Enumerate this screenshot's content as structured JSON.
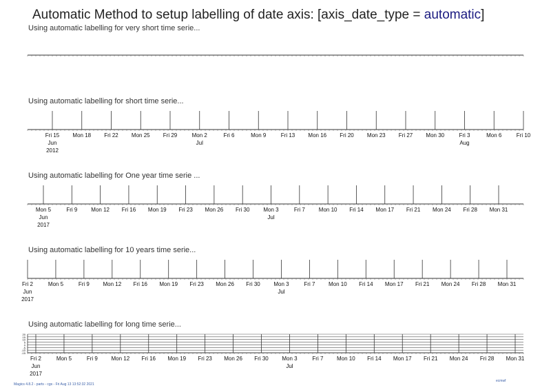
{
  "page": {
    "title_prefix": "Automatic Method to setup labelling of date axis: [axis_date_type = ",
    "title_highlight": "automatic",
    "title_suffix": "]",
    "footer": "Magics 4.8.2 - parts - cgs - Fri Aug 13 13:52:32 2021",
    "logo_text": "ecmwf"
  },
  "chart_data": [
    {
      "type": "line",
      "title": "Using automatic labelling for very short time serie...",
      "x_labels": [],
      "year_label": null,
      "grid": false
    },
    {
      "type": "line",
      "title": "Using automatic labelling for short time serie...",
      "x_labels": [
        {
          "day": "Fri 15",
          "month": "Jun",
          "year": "2012"
        },
        {
          "day": "Mon 18"
        },
        {
          "day": "Fri 22"
        },
        {
          "day": "Mon 25"
        },
        {
          "day": "Fri 29"
        },
        {
          "day": "Mon 2",
          "month": "Jul"
        },
        {
          "day": "Fri 6"
        },
        {
          "day": "Mon 9"
        },
        {
          "day": "Fri 13"
        },
        {
          "day": "Mon 16"
        },
        {
          "day": "Fri 20"
        },
        {
          "day": "Mon 23"
        },
        {
          "day": "Fri 27"
        },
        {
          "day": "Mon 30"
        },
        {
          "day": "Fri 3",
          "month": "Aug"
        },
        {
          "day": "Mon 6"
        },
        {
          "day": "Fri 10"
        }
      ],
      "grid": false
    },
    {
      "type": "line",
      "title": "Using automatic labelling for One year time serie ...",
      "x_labels": [
        {
          "day": "Mon 5",
          "month": "Jun",
          "year": "2017"
        },
        {
          "day": "Fri 9"
        },
        {
          "day": "Mon 12"
        },
        {
          "day": "Fri 16"
        },
        {
          "day": "Mon 19"
        },
        {
          "day": "Fri 23"
        },
        {
          "day": "Mon 26"
        },
        {
          "day": "Fri 30"
        },
        {
          "day": "Mon 3",
          "month": "Jul"
        },
        {
          "day": "Fri 7"
        },
        {
          "day": "Mon 10"
        },
        {
          "day": "Fri 14"
        },
        {
          "day": "Mon 17"
        },
        {
          "day": "Fri 21"
        },
        {
          "day": "Mon 24"
        },
        {
          "day": "Fri 28"
        },
        {
          "day": "Mon 31"
        }
      ],
      "grid": false
    },
    {
      "type": "line",
      "title": "Using automatic labelling for 10 years time serie...",
      "x_labels": [
        {
          "day": "Fri 2",
          "month": "Jun",
          "year": "2017"
        },
        {
          "day": "Mon 5"
        },
        {
          "day": "Fri 9"
        },
        {
          "day": "Mon 12"
        },
        {
          "day": "Fri 16"
        },
        {
          "day": "Mon 19"
        },
        {
          "day": "Fri 23"
        },
        {
          "day": "Mon 26"
        },
        {
          "day": "Fri 30"
        },
        {
          "day": "Mon 3",
          "month": "Jul"
        },
        {
          "day": "Fri 7"
        },
        {
          "day": "Mon 10"
        },
        {
          "day": "Fri 14"
        },
        {
          "day": "Mon 17"
        },
        {
          "day": "Fri 21"
        },
        {
          "day": "Mon 24"
        },
        {
          "day": "Fri 28"
        },
        {
          "day": "Mon 31"
        }
      ],
      "grid": false
    },
    {
      "type": "line",
      "title": "Using automatic labelling for long time serie...",
      "x_labels": [
        {
          "day": "Fri 2",
          "month": "Jun",
          "year": "2017"
        },
        {
          "day": "Mon 5"
        },
        {
          "day": "Fri 9"
        },
        {
          "day": "Mon 12"
        },
        {
          "day": "Fri 16"
        },
        {
          "day": "Mon 19"
        },
        {
          "day": "Fri 23"
        },
        {
          "day": "Mon 26"
        },
        {
          "day": "Fri 30"
        },
        {
          "day": "Mon 3",
          "month": "Jul"
        },
        {
          "day": "Fri 7"
        },
        {
          "day": "Mon 10"
        },
        {
          "day": "Fri 14"
        },
        {
          "day": "Mon 17"
        },
        {
          "day": "Fri 21"
        },
        {
          "day": "Mon 24"
        },
        {
          "day": "Fri 28"
        },
        {
          "day": "Mon 31"
        }
      ],
      "y_labels": [
        "20",
        "15",
        "10",
        "5",
        "0",
        "-5",
        "-10",
        "-15"
      ],
      "grid": true
    }
  ]
}
